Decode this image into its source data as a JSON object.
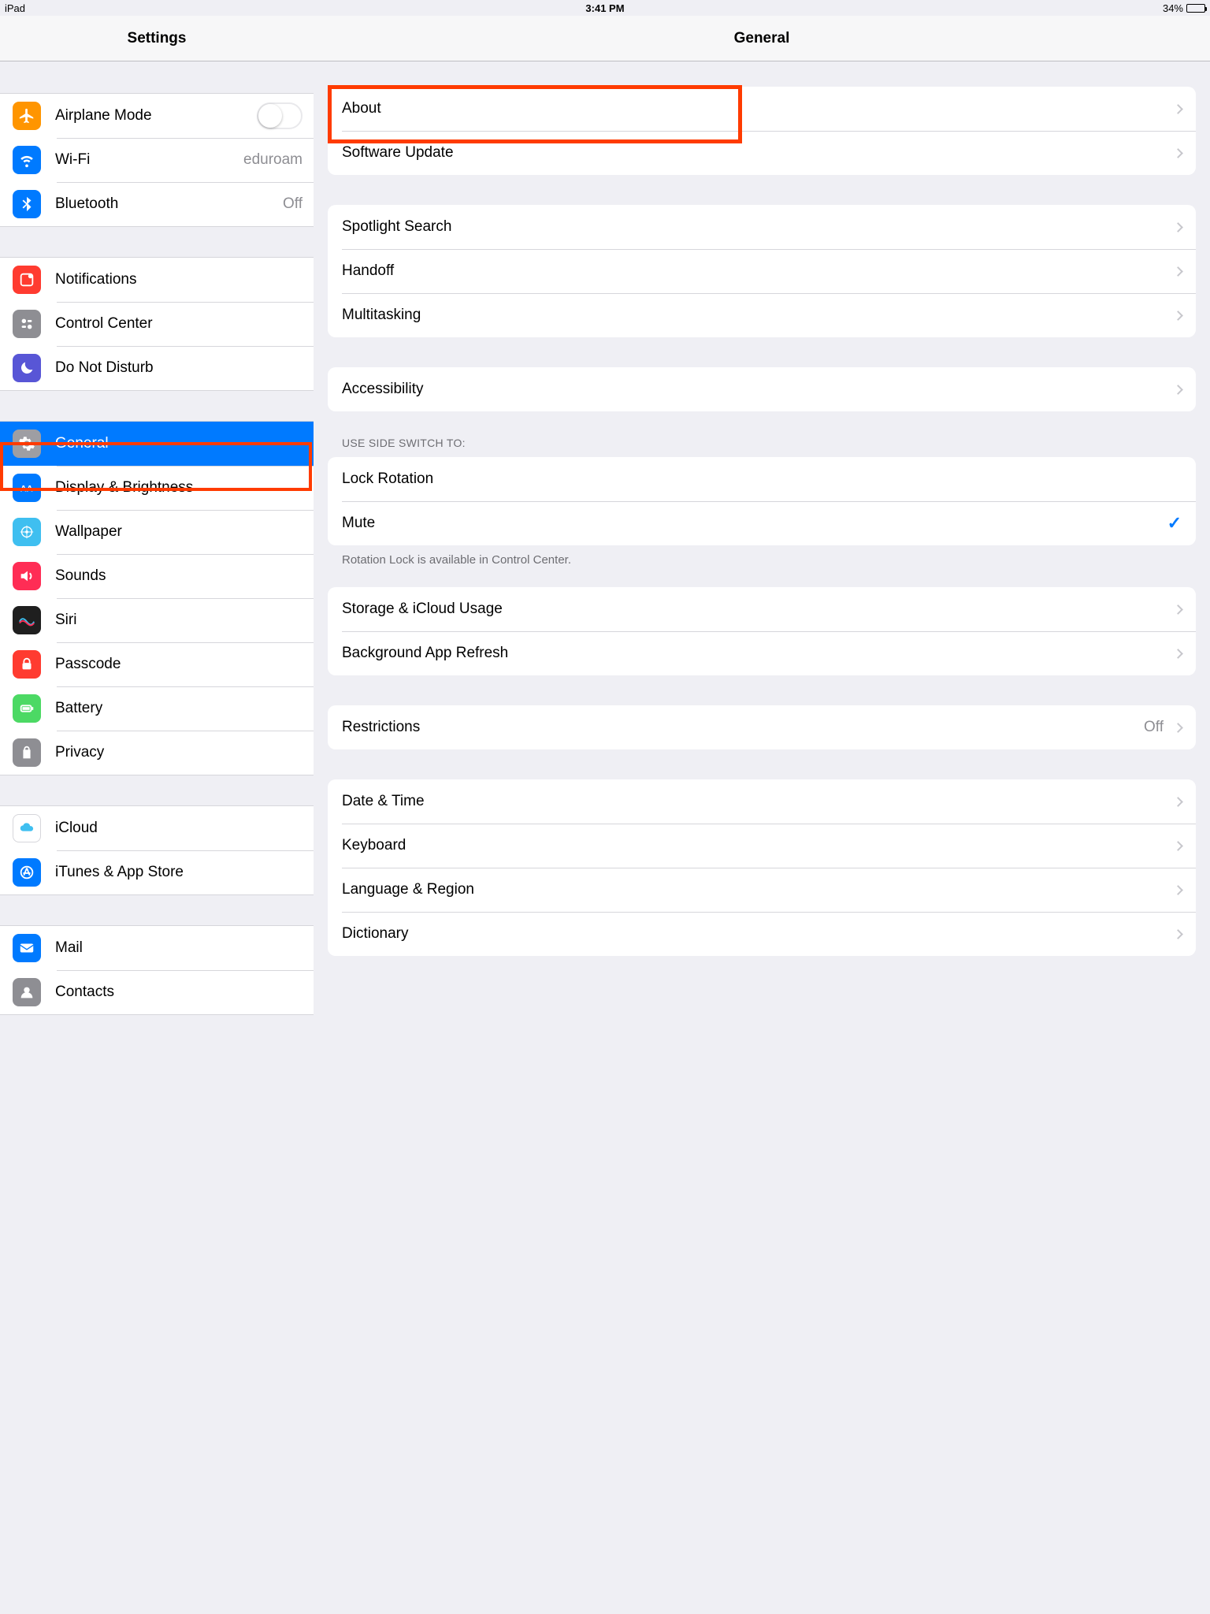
{
  "status": {
    "device": "iPad",
    "time": "3:41 PM",
    "battery_percent": "34%"
  },
  "sidebar": {
    "title": "Settings",
    "groups": [
      {
        "rows": [
          {
            "label": "Airplane Mode",
            "type": "toggle"
          },
          {
            "label": "Wi-Fi",
            "value": "eduroam"
          },
          {
            "label": "Bluetooth",
            "value": "Off"
          }
        ]
      },
      {
        "rows": [
          {
            "label": "Notifications"
          },
          {
            "label": "Control Center"
          },
          {
            "label": "Do Not Disturb"
          }
        ]
      },
      {
        "rows": [
          {
            "label": "General",
            "selected": true
          },
          {
            "label": "Display & Brightness"
          },
          {
            "label": "Wallpaper"
          },
          {
            "label": "Sounds"
          },
          {
            "label": "Siri"
          },
          {
            "label": "Passcode"
          },
          {
            "label": "Battery"
          },
          {
            "label": "Privacy"
          }
        ]
      },
      {
        "rows": [
          {
            "label": "iCloud"
          },
          {
            "label": "iTunes & App Store"
          }
        ]
      },
      {
        "rows": [
          {
            "label": "Mail"
          },
          {
            "label": "Contacts"
          }
        ]
      }
    ]
  },
  "detail": {
    "title": "General",
    "sections": [
      {
        "rows": [
          {
            "label": "About",
            "chevron": true,
            "highlight": true
          },
          {
            "label": "Software Update",
            "chevron": true
          }
        ]
      },
      {
        "rows": [
          {
            "label": "Spotlight Search",
            "chevron": true
          },
          {
            "label": "Handoff",
            "chevron": true
          },
          {
            "label": "Multitasking",
            "chevron": true
          }
        ]
      },
      {
        "rows": [
          {
            "label": "Accessibility",
            "chevron": true
          }
        ]
      },
      {
        "header": "USE SIDE SWITCH TO:",
        "rows": [
          {
            "label": "Lock Rotation"
          },
          {
            "label": "Mute",
            "check": true
          }
        ],
        "footer": "Rotation Lock is available in Control Center."
      },
      {
        "rows": [
          {
            "label": "Storage & iCloud Usage",
            "chevron": true
          },
          {
            "label": "Background App Refresh",
            "chevron": true
          }
        ]
      },
      {
        "rows": [
          {
            "label": "Restrictions",
            "value": "Off",
            "chevron": true
          }
        ]
      },
      {
        "rows": [
          {
            "label": "Date & Time",
            "chevron": true
          },
          {
            "label": "Keyboard",
            "chevron": true
          },
          {
            "label": "Language & Region",
            "chevron": true
          },
          {
            "label": "Dictionary",
            "chevron": true
          }
        ]
      }
    ]
  }
}
